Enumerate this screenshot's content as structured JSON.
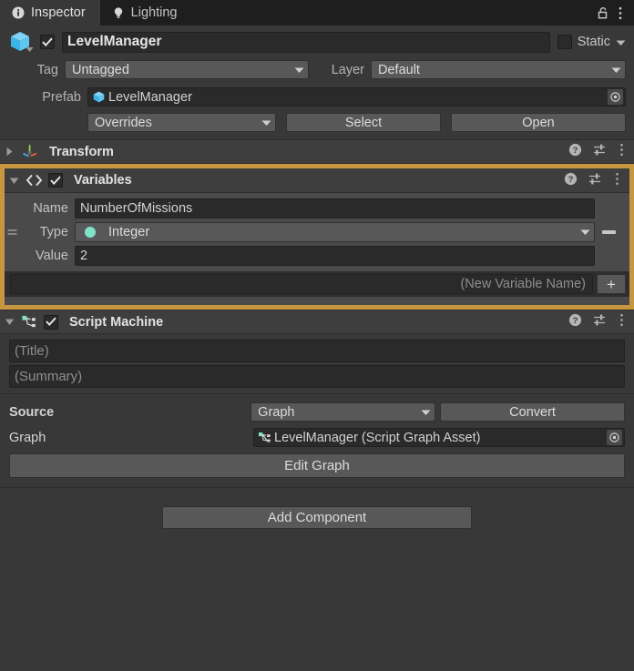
{
  "tabs": [
    {
      "label": "Inspector",
      "icon": "info-icon",
      "active": true
    },
    {
      "label": "Lighting",
      "icon": "lightbulb-icon",
      "active": false
    }
  ],
  "tabbar_actions": [
    {
      "name": "lock-icon",
      "label": ""
    },
    {
      "name": "tab-menu-icon",
      "label": ""
    }
  ],
  "gameobject": {
    "icon": "prefab-cube-icon",
    "enabled": true,
    "name": "LevelManager",
    "static_label": "Static",
    "static_checked": false,
    "tag_label": "Tag",
    "tag_value": "Untagged",
    "layer_label": "Layer",
    "layer_value": "Default"
  },
  "prefab": {
    "label": "Prefab",
    "asset_name": "LevelManager",
    "overrides_label": "Overrides",
    "select_label": "Select",
    "open_label": "Open"
  },
  "components": [
    {
      "title": "Transform",
      "icon": "transform-move-icon",
      "expanded": false,
      "has_checkbox": false,
      "highlighted": false
    },
    {
      "title": "Variables",
      "icon": "code-brackets-icon",
      "expanded": true,
      "has_checkbox": true,
      "checked": true,
      "highlighted": true
    },
    {
      "title": "Script Machine",
      "icon": "script-graph-icon",
      "expanded": true,
      "has_checkbox": true,
      "checked": true,
      "highlighted": false
    }
  ],
  "header_icons": {
    "help": "help-icon",
    "preset": "preset-settings-icon",
    "menu": "component-menu-icon"
  },
  "variables": {
    "rows": [
      {
        "label": "Name",
        "value": "NumberOfMissions",
        "kind": "text"
      },
      {
        "label": "Type",
        "value": "Integer",
        "kind": "popup",
        "swatch": "#7fe3c8"
      },
      {
        "label": "Value",
        "value": "2",
        "kind": "text"
      }
    ],
    "new_variable_placeholder": "(New Variable Name)",
    "add_label": "+",
    "remove_label": "–"
  },
  "script_machine": {
    "title_placeholder": "(Title)",
    "summary_placeholder": "(Summary)",
    "source_label": "Source",
    "source_value": "Graph",
    "convert_label": "Convert",
    "graph_label": "Graph",
    "graph_value": "LevelManager (Script Graph Asset)",
    "edit_graph_label": "Edit Graph"
  },
  "add_component_label": "Add Component",
  "colors": {
    "highlight": "#c8963e",
    "panel_bg": "#383838",
    "component_header_bg": "#3e3e3e",
    "variables_body_bg": "#4a4a4a",
    "field_bg": "#2a2a2a",
    "button_bg": "#585858",
    "teal_accent": "#7fe3c8",
    "prefab_blue": "#4ec2f0"
  }
}
